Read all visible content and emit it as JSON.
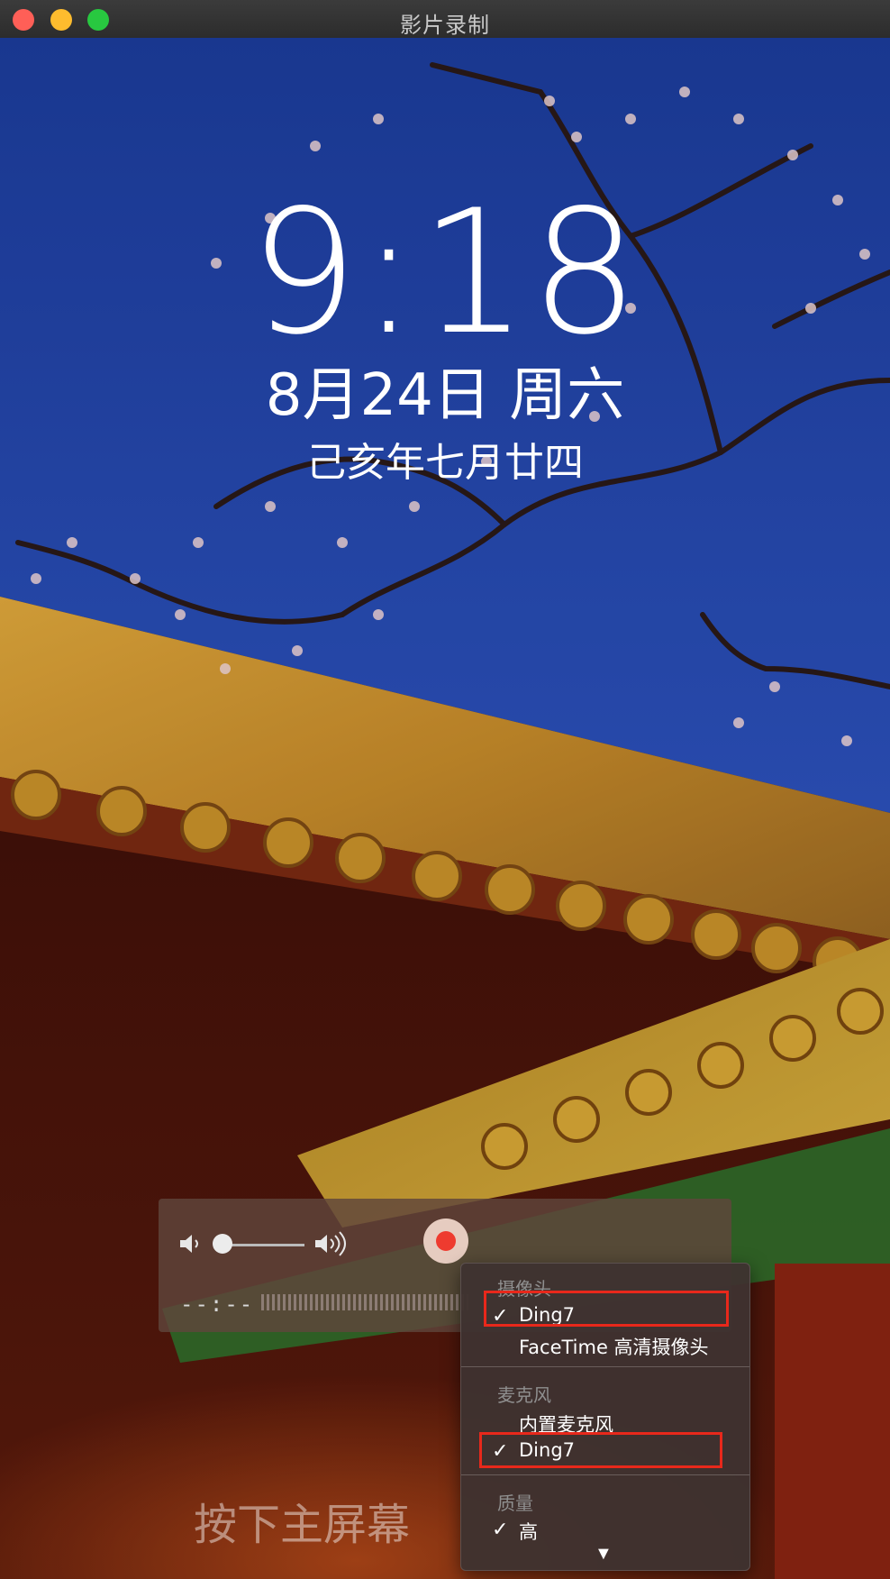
{
  "window": {
    "title": "影片录制"
  },
  "lockscreen": {
    "time": "9:18",
    "date": "8月24日 周六",
    "lunar_date": "己亥年七月廿四",
    "hint": "按下主屏幕"
  },
  "recorder": {
    "elapsed": "--:--",
    "volume_level": 0.1
  },
  "menu": {
    "camera_header": "摄像头",
    "camera_options": [
      "Ding7",
      "FaceTime 高清摄像头"
    ],
    "camera_selected": "Ding7",
    "mic_header": "麦克风",
    "mic_options": [
      "内置麦克风",
      "Ding7"
    ],
    "mic_selected": "Ding7",
    "quality_header": "质量",
    "quality_options": [
      "高"
    ],
    "quality_selected": "高",
    "check": "✓",
    "more": "▼"
  },
  "colors": {
    "highlight": "#e8281b",
    "record": "#ee3b2f"
  }
}
